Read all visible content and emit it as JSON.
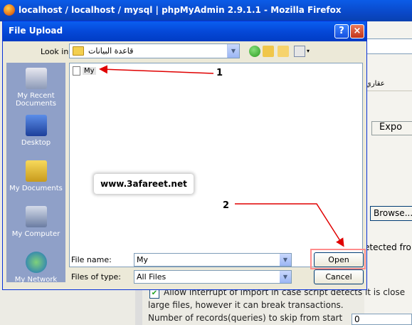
{
  "browser": {
    "title": "localhost / localhost / mysql | phpMyAdmin 2.9.1.1 - Mozilla Firefox"
  },
  "background": {
    "tab_text": "عقاري",
    "export_label": "Expo",
    "browse_label": "Browse...",
    "detected_text": "etected fro",
    "allow_interrupt_text": "Allow interrupt of import in case script detects it is close",
    "large_files_text": "large files, however it can break transactions.",
    "skip_label": "Number of records(queries) to skip from start",
    "skip_value": "0"
  },
  "dialog": {
    "title": "File Upload",
    "help_label": "?",
    "close_label": "×",
    "look_in_label": "Look in:",
    "look_in_value": "قاعدة البيانات",
    "places": [
      {
        "label": "My Recent Documents"
      },
      {
        "label": "Desktop"
      },
      {
        "label": "My Documents"
      },
      {
        "label": "My Computer"
      },
      {
        "label": "My Network"
      }
    ],
    "files": [
      {
        "name": "My"
      }
    ],
    "watermark": "www.3afareet.net",
    "annotations": {
      "one": "1",
      "two": "2"
    },
    "file_name_label": "File name:",
    "file_name_value": "My",
    "file_type_label": "Files of type:",
    "file_type_value": "All Files",
    "open_label": "Open",
    "cancel_label": "Cancel"
  },
  "colors": {
    "accent": "#0a48c8",
    "annotation": "#e00000",
    "highlight": "#ff8c8c"
  }
}
